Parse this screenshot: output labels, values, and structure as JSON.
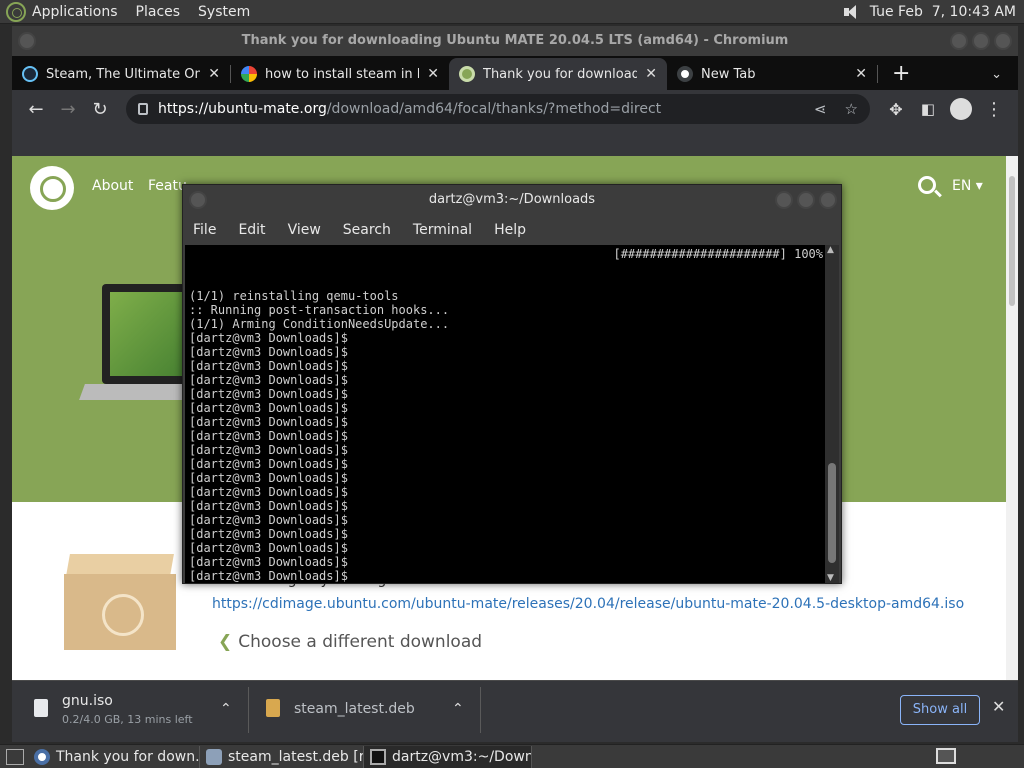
{
  "top_panel": {
    "menus": [
      "Applications",
      "Places",
      "System"
    ],
    "clock": "Tue Feb  7, 10:43 AM"
  },
  "browser": {
    "window_title": "Thank you for downloading Ubuntu MATE 20.04.5 LTS (amd64) - Chromium",
    "tabs": [
      {
        "label": "Steam, The Ultimate Onlin",
        "favicon": "steam-icon",
        "active": false
      },
      {
        "label": "how to install steam in linu",
        "favicon": "google-icon",
        "active": false
      },
      {
        "label": "Thank you for downloading",
        "favicon": "ubuntu-mate-icon",
        "active": true
      },
      {
        "label": "New Tab",
        "favicon": "chromium-icon",
        "active": false
      }
    ],
    "new_tab_label": "+",
    "url_host": "https://ubuntu-mate.org",
    "url_rest": "/download/amd64/focal/thanks/?method=direct"
  },
  "page": {
    "nav": [
      "About",
      "Featu"
    ],
    "lang": "EN",
    "not_working": "Not working? Try clicking the link.",
    "download_url": "https://cdimage.ubuntu.com/ubuntu-mate/releases/20.04/release/ubuntu-mate-20.04.5-desktop-amd64.iso",
    "choose_link": "Choose a different download",
    "brand_color": "#87a556"
  },
  "downloads": {
    "items": [
      {
        "name": "gnu.iso",
        "status": "0.2/4.0 GB, 13 mins left"
      },
      {
        "name": "steam_latest.deb",
        "status": ""
      }
    ],
    "show_all": "Show all"
  },
  "terminal": {
    "title": "dartz@vm3:~/Downloads",
    "menus": [
      "File",
      "Edit",
      "View",
      "Search",
      "Terminal",
      "Help"
    ],
    "lines": [
      "(1/1) reinstalling qemu-tools",
      ":: Running post-transaction hooks...",
      "(1/1) Arming ConditionNeedsUpdate...",
      "[dartz@vm3 Downloads]$",
      "[dartz@vm3 Downloads]$",
      "[dartz@vm3 Downloads]$",
      "[dartz@vm3 Downloads]$",
      "[dartz@vm3 Downloads]$",
      "[dartz@vm3 Downloads]$",
      "[dartz@vm3 Downloads]$",
      "[dartz@vm3 Downloads]$",
      "[dartz@vm3 Downloads]$",
      "[dartz@vm3 Downloads]$",
      "[dartz@vm3 Downloads]$",
      "[dartz@vm3 Downloads]$",
      "[dartz@vm3 Downloads]$",
      "[dartz@vm3 Downloads]$",
      "[dartz@vm3 Downloads]$",
      "[dartz@vm3 Downloads]$",
      "[dartz@vm3 Downloads]$",
      "[dartz@vm3 Downloads]$",
      "[dartz@vm3 Downloads]$",
      "[dartz@vm3 Downloads]$",
      "[dartz@vm3 Downloads]$",
      "[dartz@vm3 Downloads]$"
    ],
    "progress": "[######################] 100%"
  },
  "taskbar": {
    "tasks": [
      {
        "label": "Thank you for down...",
        "icon": "chromium-icon"
      },
      {
        "label": "steam_latest.deb [r...",
        "icon": "package-icon"
      },
      {
        "label": "dartz@vm3:~/Down...",
        "icon": "terminal-icon"
      }
    ]
  }
}
